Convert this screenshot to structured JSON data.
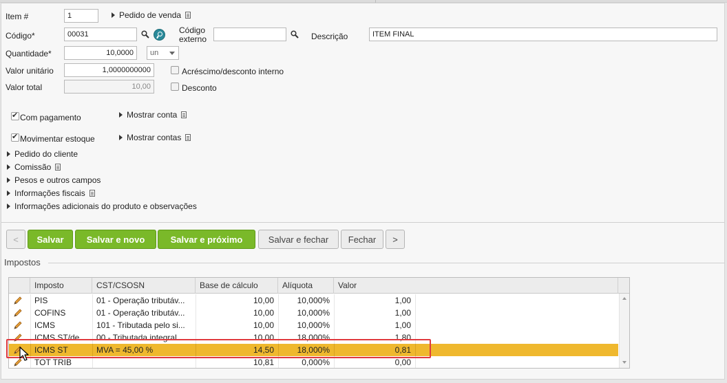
{
  "form": {
    "item_label": "Item #",
    "item_value": "1",
    "pedido_venda": "Pedido de venda",
    "codigo_label": "Código*",
    "codigo_value": "00031",
    "codigo_externo_label_1": "Código",
    "codigo_externo_label_2": "externo",
    "codigo_externo_value": "",
    "descricao_label": "Descrição",
    "descricao_value": "ITEM FINAL",
    "quantidade_label": "Quantidade*",
    "quantidade_value": "10,0000",
    "unidade_value": "un",
    "valor_unitario_label": "Valor unitário",
    "valor_unitario_value": "1,0000000000",
    "acrescimo_label": "Acréscimo/desconto interno",
    "valor_total_label": "Valor total",
    "valor_total_value": "10,00",
    "desconto_label": "Desconto"
  },
  "options": {
    "com_pagamento": "Com pagamento",
    "mostrar_conta": "Mostrar conta",
    "movimentar_estoque": "Movimentar estoque",
    "mostrar_contas": "Mostrar contas"
  },
  "sections": [
    "Pedido do cliente",
    "Comissão",
    "Pesos e outros campos",
    "Informações fiscais",
    "Informações adicionais do produto e observações"
  ],
  "buttons": {
    "prev": "<",
    "salvar": "Salvar",
    "salvar_novo": "Salvar e novo",
    "salvar_proximo": "Salvar e próximo",
    "salvar_fechar": "Salvar e fechar",
    "fechar": "Fechar",
    "next": ">"
  },
  "impostos": {
    "title": "Impostos",
    "columns": [
      "Imposto",
      "CST/CSOSN",
      "Base de cálculo",
      "Alíquota",
      "Valor"
    ],
    "rows": [
      {
        "imposto": "PIS",
        "cst": "01 - Operação tributáv...",
        "base": "10,00",
        "aliquota": "10,000%",
        "valor": "1,00"
      },
      {
        "imposto": "COFINS",
        "cst": "01 - Operação tributáv...",
        "base": "10,00",
        "aliquota": "10,000%",
        "valor": "1,00"
      },
      {
        "imposto": "ICMS",
        "cst": "101 - Tributada pelo si...",
        "base": "10,00",
        "aliquota": "10,000%",
        "valor": "1,00"
      },
      {
        "imposto": "ICMS ST/de",
        "cst": "00 - Tributada integral",
        "base": "10,00",
        "aliquota": "18,000%",
        "valor": "1,80"
      },
      {
        "imposto": "ICMS ST",
        "cst": "MVA = 45,00 %",
        "base": "14,50",
        "aliquota": "18,000%",
        "valor": "0,81"
      },
      {
        "imposto": "TOT TRIB",
        "cst": "",
        "base": "10,81",
        "aliquota": "0,000%",
        "valor": "0,00"
      }
    ]
  },
  "colors": {
    "green_button": "#7ab929",
    "selected_row": "#efb82e",
    "highlight": "#e0393e"
  }
}
